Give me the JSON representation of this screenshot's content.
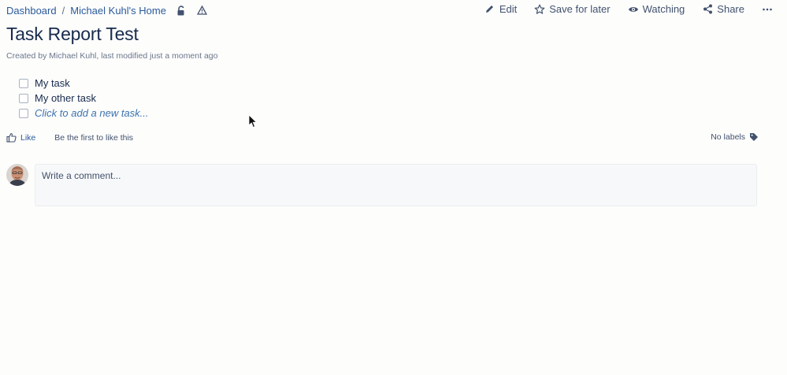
{
  "breadcrumb": {
    "items": [
      "Dashboard",
      "Michael Kuhl's Home"
    ],
    "separator": "/",
    "restrictions_icon": "unlock-icon",
    "analytics_icon": "warning-triangle-icon"
  },
  "toolbar": {
    "edit_label": "Edit",
    "edit_icon": "pencil-icon",
    "save_label": "Save for later",
    "save_icon": "star-icon",
    "watch_label": "Watching",
    "watch_icon": "eye-icon",
    "share_label": "Share",
    "share_icon": "share-icon",
    "more_icon": "more-horizontal-icon"
  },
  "page": {
    "title": "Task Report Test",
    "byline": "Created by Michael Kuhl, last modified just a moment ago"
  },
  "tasks": {
    "items": [
      {
        "label": "My task",
        "checked": false
      },
      {
        "label": "My other task",
        "checked": false
      }
    ],
    "new_task_placeholder": "Click to add a new task..."
  },
  "likes": {
    "like_label": "Like",
    "like_text": "Be the first to like this"
  },
  "labels": {
    "text": "No labels",
    "icon": "tag-icon"
  },
  "comment": {
    "placeholder": "Write a comment..."
  },
  "colors": {
    "link": "#2a5a9c",
    "text": "#172b4d",
    "muted": "#6b778c",
    "background": "#fdfdfc"
  }
}
